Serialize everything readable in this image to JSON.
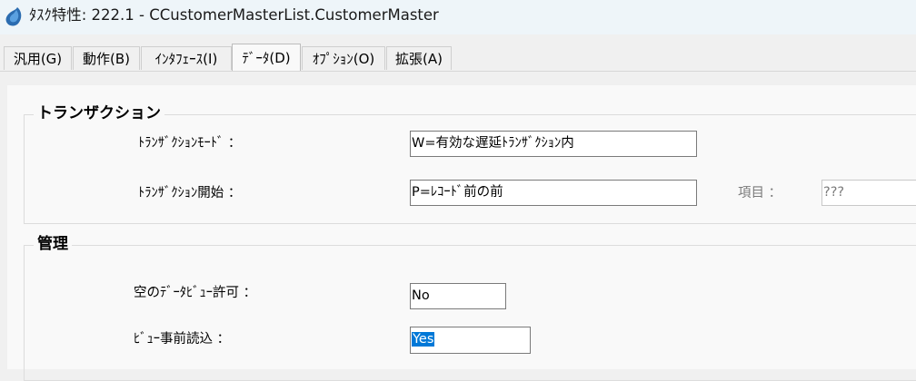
{
  "window": {
    "title": "ﾀｽｸ特性: 222.1 -   CCustomerMasterList.CustomerMaster"
  },
  "tabs": [
    {
      "label": "汎用(G)"
    },
    {
      "label": "動作(B)"
    },
    {
      "label": "ｲﾝﾀﾌｪｰｽ(I)"
    },
    {
      "label": "ﾃﾞｰﾀ(D)"
    },
    {
      "label": "ｵﾌﾟｼｮﾝ(O)"
    },
    {
      "label": "拡張(A)"
    }
  ],
  "active_tab": "ﾃﾞｰﾀ(D)",
  "transaction": {
    "title": "トランザクション",
    "mode_label": "ﾄﾗﾝｻﾞｸｼｮﾝﾓｰﾄﾞ ：",
    "mode_value": "W=有効な遅延ﾄﾗﾝｻﾞｸｼｮﾝ内",
    "start_label": "ﾄﾗﾝｻﾞｸｼｮﾝ開始 ：",
    "start_value": "P=ﾚｺｰﾄﾞ前の前",
    "item_label": "項目 ：",
    "item_value": "???"
  },
  "management": {
    "title": "管理",
    "empty_view_label": "空のﾃﾞｰﾀﾋﾞｭｰ許可 ：",
    "empty_view_value": "No",
    "preload_label": "ﾋﾞｭｰ事前読込 ：",
    "preload_value": "Yes"
  },
  "colors": {
    "titlebar_bg": "#eef5f9",
    "panel_bg": "#f9f9f9",
    "selection": "#0078d7"
  }
}
